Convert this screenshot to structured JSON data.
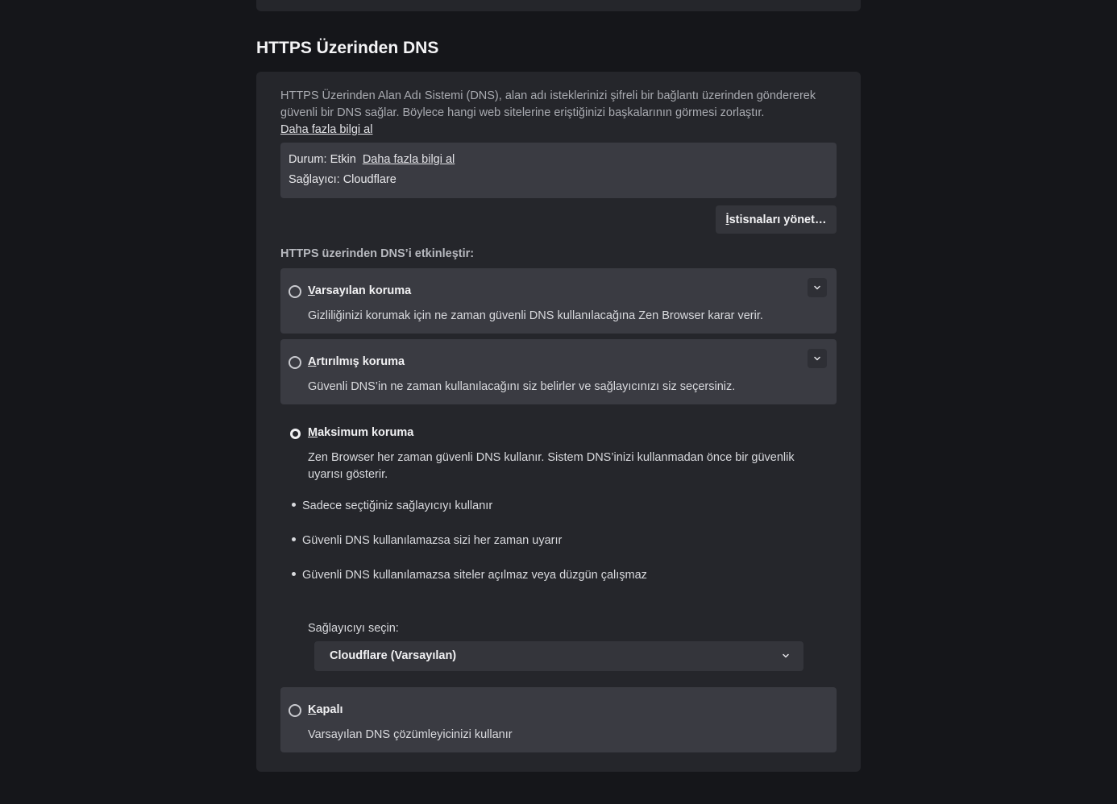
{
  "section_title": "HTTPS Üzerinden DNS",
  "description": "HTTPS Üzerinden Alan Adı Sistemi (DNS), alan adı isteklerinizi şifreli bir bağlantı üzerinden göndererek güvenli bir DNS sağlar. Böylece hangi web sitelerine eriştiğinizi başkalarının görmesi zorlaştır.",
  "learn_more": "Daha fazla bilgi al",
  "status": {
    "state_text": "Durum: Etkin",
    "learn_more": "Daha fazla bilgi al",
    "provider_text": "Sağlayıcı: Cloudflare"
  },
  "manage_exceptions": {
    "accesskey": "İ",
    "rest": "stisnaları yönet…"
  },
  "enable_label": "HTTPS üzerinden DNS’i etkinleştir:",
  "options": {
    "default": {
      "accesskey": "V",
      "title_rest": "arsayılan koruma",
      "desc": "Gizliliğinizi korumak için ne zaman güvenli DNS kullanılacağına Zen Browser karar verir.",
      "selected": false
    },
    "increased": {
      "accesskey": "A",
      "title_rest": "rtırılmış koruma",
      "desc": "Güvenli DNS’in ne zaman kullanılacağını siz belirler ve sağlayıcınızı siz seçersiniz.",
      "selected": false
    },
    "max": {
      "accesskey": "M",
      "title_rest": "aksimum koruma",
      "desc": "Zen Browser her zaman güvenli DNS kullanır. Sistem DNS’inizi kullanmadan önce bir güvenlik uyarısı gösterir.",
      "selected": true,
      "bullets": [
        "Sadece seçtiğiniz sağlayıcıyı kullanır",
        "Güvenli DNS kullanılamazsa sizi her zaman uyarır",
        "Güvenli DNS kullanılamazsa siteler açılmaz veya düzgün çalışmaz"
      ],
      "provider_label": "Sağlayıcıyı seçin:",
      "provider_value": "Cloudflare (Varsayılan)"
    },
    "off": {
      "accesskey": "K",
      "title_rest": "apalı",
      "desc": "Varsayılan DNS çözümleyicinizi kullanır",
      "selected": false
    }
  },
  "icons": {
    "expand": "chevron-down-icon",
    "select": "chevron-down-icon"
  },
  "colors": {
    "background": "#15161a",
    "card": "#25262b",
    "option_box": "#3a3b42"
  }
}
